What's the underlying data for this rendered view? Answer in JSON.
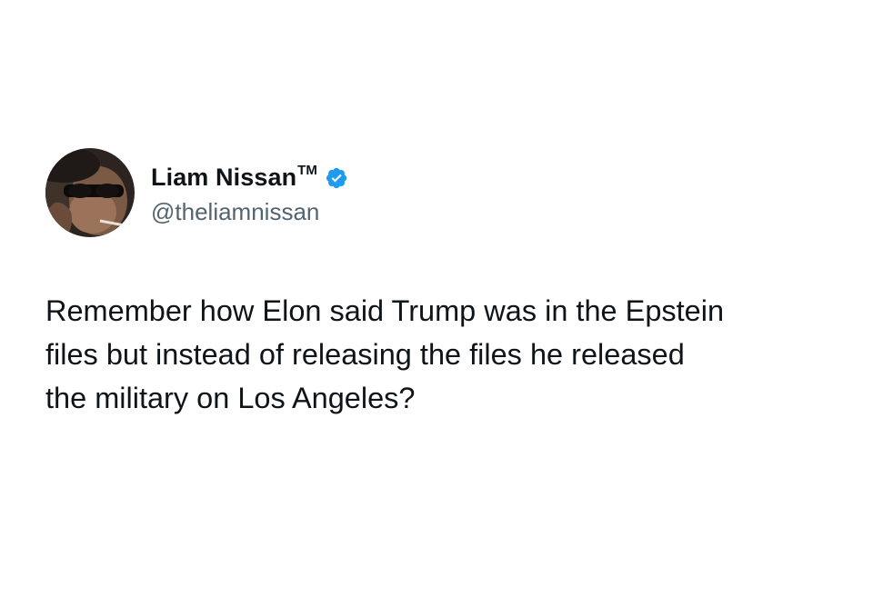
{
  "author": {
    "display_name": "Liam Nissan",
    "trademark": "TM",
    "handle": "@theliamnissan",
    "verified_color": "#1d9bf0",
    "avatar_icon": "profile-photo"
  },
  "tweet": {
    "lines": [
      "Remember how Elon said Trump was in the Epstein",
      "files but instead of releasing the files he released",
      "the military on Los Angeles?"
    ]
  }
}
